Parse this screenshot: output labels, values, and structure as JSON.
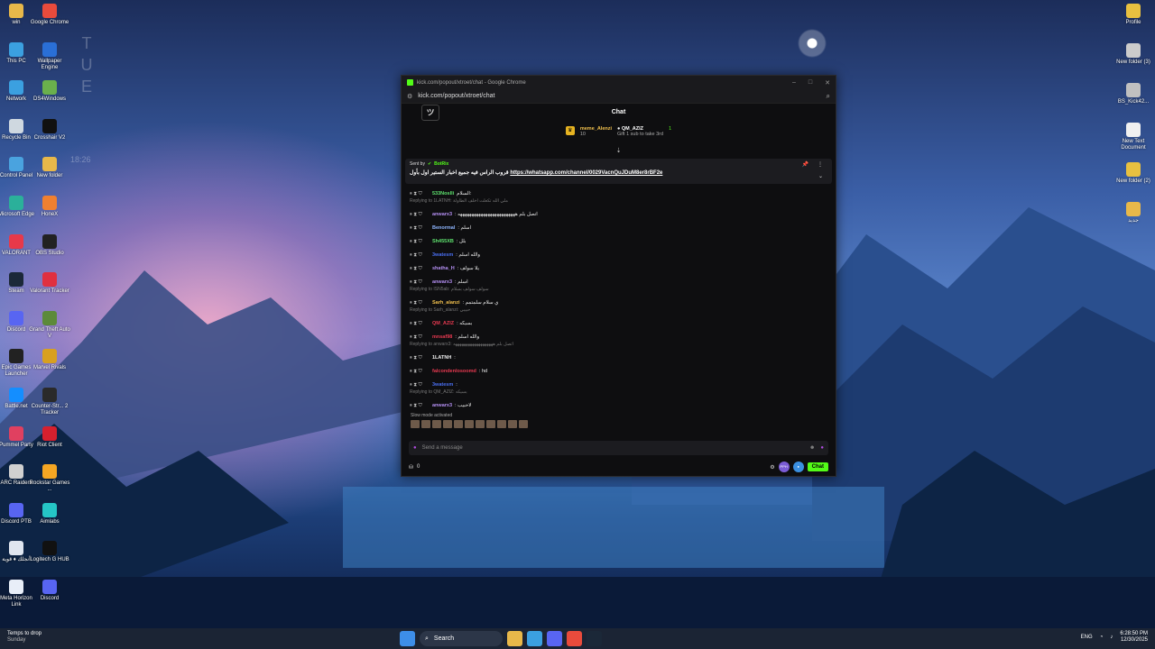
{
  "desktop": {
    "left_col1": [
      {
        "label": "win",
        "icon": "folder-icon",
        "color": "#e8b84a"
      },
      {
        "label": "This PC",
        "icon": "pc-icon",
        "color": "#3ba0e0"
      },
      {
        "label": "Network",
        "icon": "network-icon",
        "color": "#3ba0e0"
      },
      {
        "label": "Recycle Bin",
        "icon": "recycle-bin-icon",
        "color": "#cfd8e0"
      },
      {
        "label": "Control Panel",
        "icon": "control-panel-icon",
        "color": "#4aa3df"
      },
      {
        "label": "Microsoft Edge",
        "icon": "edge-icon",
        "color": "#2bb09a"
      },
      {
        "label": "VALORANT",
        "icon": "valorant-icon",
        "color": "#e8394a"
      },
      {
        "label": "Steam",
        "icon": "steam-icon",
        "color": "#1b2838"
      },
      {
        "label": "Discord",
        "icon": "discord-icon",
        "color": "#5865f2"
      },
      {
        "label": "Epic Games Launcher",
        "icon": "epic-icon",
        "color": "#222"
      },
      {
        "label": "Battle.net",
        "icon": "battlenet-icon",
        "color": "#148eff"
      },
      {
        "label": "Pummel Party",
        "icon": "pummel-icon",
        "color": "#e04060"
      },
      {
        "label": "ARC Raiders",
        "icon": "arc-icon",
        "color": "#d0d0d0"
      },
      {
        "label": "Discord PTB",
        "icon": "discord-ptb-icon",
        "color": "#5865f2"
      },
      {
        "label": "أنجلك ♦ ﻗﻮﻳﺔ",
        "icon": "doc-icon",
        "color": "#e0e6f0"
      },
      {
        "label": "Meta Horizon Link",
        "icon": "meta-icon",
        "color": "#e8eef8"
      }
    ],
    "left_col2": [
      {
        "label": "Google Chrome",
        "icon": "chrome-icon",
        "color": "#e94b3c"
      },
      {
        "label": "Wallpaper Engine",
        "icon": "wallpaper-engine-icon",
        "color": "#2a6fd6"
      },
      {
        "label": "DS4Windows",
        "icon": "ds4-icon",
        "color": "#6ab04c"
      },
      {
        "label": "Crosshair V2",
        "icon": "crosshair-icon",
        "color": "#111"
      },
      {
        "label": "New folder",
        "icon": "folder-icon",
        "color": "#e8b84a"
      },
      {
        "label": "HoneX",
        "icon": "honex-icon",
        "color": "#f08030"
      },
      {
        "label": "OBS Studio",
        "icon": "obs-icon",
        "color": "#222"
      },
      {
        "label": "Valorant Tracker",
        "icon": "tracker-icon",
        "color": "#e03040"
      },
      {
        "label": "Grand Theft Auto V",
        "icon": "gta-icon",
        "color": "#5c8a3a"
      },
      {
        "label": "Marvel Rivals",
        "icon": "marvel-icon",
        "color": "#d8a020"
      },
      {
        "label": "Counter-Str... 2 Tracker",
        "icon": "cs2-icon",
        "color": "#2a2a2a"
      },
      {
        "label": "Riot Client",
        "icon": "riot-icon",
        "color": "#d6202e"
      },
      {
        "label": "Rockstar Games ...",
        "icon": "rockstar-icon",
        "color": "#f5a623"
      },
      {
        "label": "Aimlabs",
        "icon": "aimlabs-icon",
        "color": "#25c6c6"
      },
      {
        "label": "Logitech G HUB",
        "icon": "ghub-icon",
        "color": "#111"
      },
      {
        "label": "Discord",
        "icon": "discord-icon",
        "color": "#5865f2"
      }
    ],
    "right_col": [
      {
        "label": "Profile",
        "icon": "profile-icon",
        "color": "#e8c040"
      },
      {
        "label": "New folder (3)",
        "icon": "folder-icon",
        "color": "#cccccc"
      },
      {
        "label": "BS_Kick42...",
        "icon": "app-icon",
        "color": "#c0c0c0"
      },
      {
        "label": "New Text Document",
        "icon": "text-doc-icon",
        "color": "#f0f0f0"
      },
      {
        "label": "New folder (2)",
        "icon": "folder-icon",
        "color": "#e8c040"
      },
      {
        "label": "ﺟﺪﻳﺪ",
        "icon": "folder-icon",
        "color": "#e8b84a"
      }
    ],
    "watermark": [
      "T",
      "U",
      "E"
    ],
    "watermark_time": "18:26"
  },
  "browser": {
    "title": "kick.com/popout/xtroet/chat - Google Chrome",
    "url": "kick.com/popout/xtroet/chat"
  },
  "chat": {
    "header": "Chat",
    "home_glyph": "ツ",
    "leaderboard": {
      "first_name": "meme_Alenzi",
      "first_count": "10",
      "second_name": "QM_AZIZ",
      "second_count": "1",
      "gift_note": "Gift 1 sub to take 3rd"
    },
    "pinned": {
      "sent_by": "Sent by",
      "bot": "BotRix",
      "message": "قروب الراس فيه جميع اخبار الستير اول بأول",
      "link": "https://whatsapp.com/channel/0029VacnQuJDuM8er8rBF2e"
    },
    "messages": [
      {
        "kind": "msg",
        "user": "533Noslli",
        "user_color": "#5fe36f",
        "text": "السلام:"
      },
      {
        "kind": "reply",
        "text": "Replying to 1LATNH: ملي الله تكعلت اخلف الطاولة"
      },
      {
        "kind": "msg",
        "user": "anwarx3",
        "user_color": "#b48ff2",
        "text": ": اتصل بلم هههههههههههههههههههههههههه"
      },
      {
        "kind": "msg",
        "user": "Benormal",
        "user_color": "#8fb6ff",
        "text": ": اسلم"
      },
      {
        "kind": "msg",
        "user": "Sh455XB",
        "user_color": "#5fe36f",
        "text": ": بلل"
      },
      {
        "kind": "msg",
        "user": "3watesm",
        "user_color": "#4a6ff2",
        "text": ": والله اسلم"
      },
      {
        "kind": "msg",
        "user": "shatha_H",
        "user_color": "#b48ff2",
        "text": ": يلا سولف"
      },
      {
        "kind": "msg",
        "user": "anwarx3",
        "user_color": "#b48ff2",
        "text": ": اسلم"
      },
      {
        "kind": "reply",
        "text": "Replying to ISN5ab: سولف سولف بسلام"
      },
      {
        "kind": "msg",
        "user": "Sarh_alanzi",
        "user_color": "#f2c14e",
        "text": ": ي سلام سلمتمم"
      },
      {
        "kind": "reply",
        "text": "Replying to Sarh_alanzi: حبيبي"
      },
      {
        "kind": "msg",
        "user": "QM_AZIZ",
        "user_color": "#e63950",
        "text": ": بسيكه"
      },
      {
        "kind": "msg",
        "user": "mnsaf98",
        "user_color": "#e63950",
        "text": ": والله اسلم"
      },
      {
        "kind": "reply",
        "text": "Replying to anwarx3: اتصل بلم هههههههههههههههههههه"
      },
      {
        "kind": "msg",
        "user": "1LATNH",
        "user_color": "#f0f0f0",
        "text": ":"
      },
      {
        "kind": "msg",
        "user": "falcondenlosoomd",
        "user_color": "#e63950",
        "text": ": hd"
      },
      {
        "kind": "msg",
        "user": "3watesm",
        "user_color": "#4a6ff2",
        "text": ":"
      },
      {
        "kind": "reply",
        "text": "Replying to QM_AZIZ: بسيكه"
      },
      {
        "kind": "msg",
        "user": "anwarx3",
        "user_color": "#b48ff2",
        "text": ": لاحبيب"
      }
    ],
    "slow_mode": "Slow mode activated",
    "input_placeholder": "Send a message",
    "points": "0",
    "chat_button": "Chat"
  },
  "taskbar": {
    "weather_line1": "Temps to drop",
    "weather_line2": "Sunday",
    "search": "Search",
    "lang": "ENG",
    "time": "6:28:50 PM",
    "date": "12/30/2025"
  }
}
